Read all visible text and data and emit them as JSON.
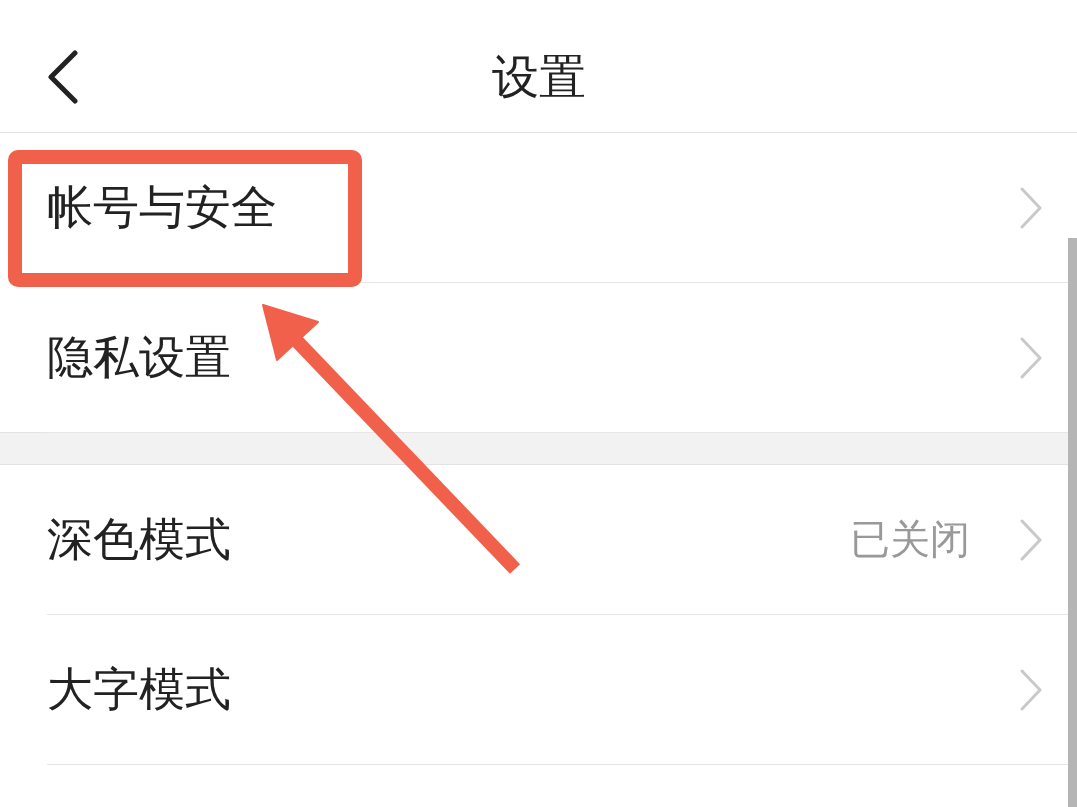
{
  "header": {
    "title": "设置"
  },
  "groups": [
    {
      "items": [
        {
          "label": "帐号与安全",
          "highlighted": true
        },
        {
          "label": "隐私设置"
        }
      ]
    },
    {
      "items": [
        {
          "label": "深色模式",
          "value": "已关闭"
        },
        {
          "label": "大字模式"
        }
      ]
    }
  ]
}
